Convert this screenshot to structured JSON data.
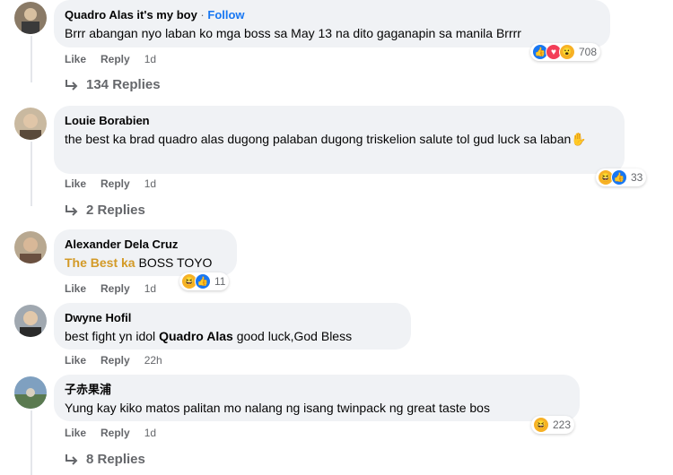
{
  "comments": [
    {
      "author": "Quadro Alas it's my boy",
      "follow_label": "Follow",
      "text": "Brrr abangan nyo laban ko mga boss sa May 13 na dito gaganapin sa manila Brrrr",
      "like": "Like",
      "reply": "Reply",
      "time": "1d",
      "reaction_count": "708",
      "reactions": [
        "like",
        "love",
        "wow"
      ],
      "replies_label": "134 Replies"
    },
    {
      "author": "Louie Borabien",
      "text": "the best ka brad quadro alas dugong palaban dugong triskelion salute tol gud luck sa laban",
      "emoji": "✋",
      "like": "Like",
      "reply": "Reply",
      "time": "1d",
      "reaction_count": "33",
      "reactions": [
        "haha",
        "like"
      ],
      "replies_label": "2 Replies"
    },
    {
      "author": "Alexander Dela Cruz",
      "mention": "The Best ka",
      "text": "BOSS TOYO",
      "like": "Like",
      "reply": "Reply",
      "time": "1d",
      "reaction_count": "11",
      "reactions": [
        "haha",
        "like"
      ]
    },
    {
      "author": "Dwyne Hofil",
      "text_before": "best fight yn idol",
      "mention": "Quadro Alas",
      "text_after": "good luck,God Bless",
      "like": "Like",
      "reply": "Reply",
      "time": "22h"
    },
    {
      "author": "子赤果浦",
      "text": "Yung kay kiko matos palitan mo nalang ng isang twinpack ng great taste bos",
      "like": "Like",
      "reply": "Reply",
      "time": "1d",
      "reaction_count": "223",
      "reactions": [
        "haha"
      ],
      "replies_label": "8 Replies"
    }
  ],
  "colors": {
    "bubble": "#f0f2f5",
    "link": "#1877f2",
    "secondary_text": "#65676b",
    "mention_orange": "#d39a27"
  }
}
